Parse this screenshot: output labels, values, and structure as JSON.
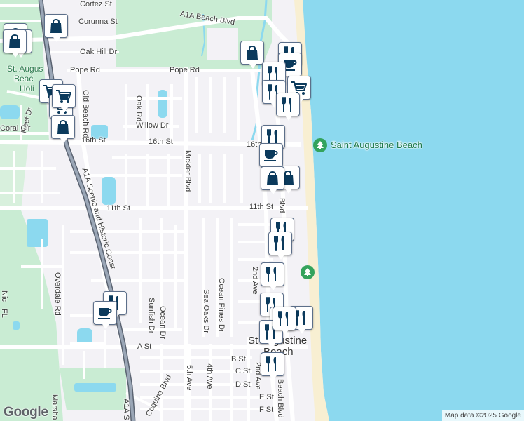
{
  "colors": {
    "water": "#8cd9ef",
    "land": "#f3f2f6",
    "park": "#c9ecd3",
    "beach": "#f8efd2",
    "pin_icon": "#0b3a5c"
  },
  "streets": {
    "cortez": "Cortez St",
    "corunna": "Corunna St",
    "oak_hill": "Oak Hill Dr",
    "pope_w": "Pope Rd",
    "pope_e": "Pope Rd",
    "a1a_beach": "A1A Beach Blvd",
    "old_beach": "Old Beach Rd",
    "reef": "Reef Dr",
    "coral": "Coral Cir",
    "oak_rd": "Oak Rd",
    "willow": "Willow Dr",
    "sixteenth_w": "16th St",
    "sixteenth_mid": "16th St",
    "sixteenth_e": "16th",
    "mickler": "Mickler Blvd",
    "eleventh_w": "11th St",
    "eleventh_e": "11th St",
    "beach_blvd_mid": "Blvd",
    "a1a_scenic": "A1A Scenic and Historic Coast",
    "overdale": "Overdale Rd",
    "ocean_pines": "Ocean Pines Dr",
    "sea_oaks": "Sea Oaks Dr",
    "second_ave_n": "2nd Ave",
    "sunfish": "Sunfish Dr",
    "ocean_dr": "Ocean Dr",
    "a_st": "A St",
    "b_st": "B St",
    "c_st": "C St",
    "d_st": "D St",
    "e_st": "E St",
    "f_st": "F St",
    "fifth_ave": "5th Ave",
    "fourth_ave": "4th Ave",
    "second_ave_s": "2nd Ave",
    "beach_blvd_s": "Beach Blvd",
    "coquina": "Coquina Blvd",
    "a1a_s": "A1A S",
    "marsh": "Marsha",
    "nic": "Nic",
    "fl": "FL"
  },
  "places": {
    "st_aug_holiday_1": "St. Augus",
    "st_aug_holiday_2": "Beac",
    "st_aug_holiday_3": "Holi",
    "saint_augustine_beach": "Saint Augustine Beach",
    "town_1": "St    Augustine",
    "town_2": "Beach"
  },
  "pins": [
    {
      "id": "pin-1",
      "icon": "shopping-bag-icon"
    },
    {
      "id": "pin-2",
      "icon": "shopping-bag-icon"
    },
    {
      "id": "pin-3",
      "icon": "shopping-bag-icon"
    },
    {
      "id": "pin-4",
      "icon": "shopping-bag-icon"
    },
    {
      "id": "pin-5",
      "icon": "shopping-cart-icon"
    },
    {
      "id": "pin-6",
      "icon": "shopping-cart-icon"
    },
    {
      "id": "pin-7",
      "icon": "shopping-cart-icon"
    },
    {
      "id": "pin-8",
      "icon": "shopping-bag-icon"
    },
    {
      "id": "pin-9",
      "icon": "restaurant-icon"
    },
    {
      "id": "pin-10",
      "icon": "cafe-icon"
    },
    {
      "id": "pin-11",
      "icon": "shopping-bag-icon"
    },
    {
      "id": "pin-12",
      "icon": "restaurant-icon"
    },
    {
      "id": "pin-13",
      "icon": "shopping-cart-icon"
    },
    {
      "id": "pin-14",
      "icon": "restaurant-icon"
    },
    {
      "id": "pin-15",
      "icon": "restaurant-icon"
    },
    {
      "id": "pin-16",
      "icon": "restaurant-icon"
    },
    {
      "id": "pin-17",
      "icon": "cafe-icon"
    },
    {
      "id": "pin-18",
      "icon": "shopping-bag-icon"
    },
    {
      "id": "pin-19",
      "icon": "shopping-bag-icon"
    },
    {
      "id": "pin-20",
      "icon": "restaurant-icon"
    },
    {
      "id": "pin-21",
      "icon": "restaurant-icon"
    },
    {
      "id": "pin-22",
      "icon": "restaurant-icon"
    },
    {
      "id": "pin-23",
      "icon": "restaurant-icon"
    },
    {
      "id": "pin-24",
      "icon": "restaurant-icon"
    },
    {
      "id": "pin-25",
      "icon": "restaurant-icon"
    },
    {
      "id": "pin-26",
      "icon": "restaurant-icon"
    },
    {
      "id": "pin-27",
      "icon": "cafe-icon"
    },
    {
      "id": "pin-28",
      "icon": "restaurant-icon"
    },
    {
      "id": "pin-29",
      "icon": "restaurant-icon"
    },
    {
      "id": "pin-30",
      "icon": "restaurant-icon"
    }
  ],
  "footer": {
    "logo": "Google",
    "attribution": "Map data ©2025 Google"
  }
}
